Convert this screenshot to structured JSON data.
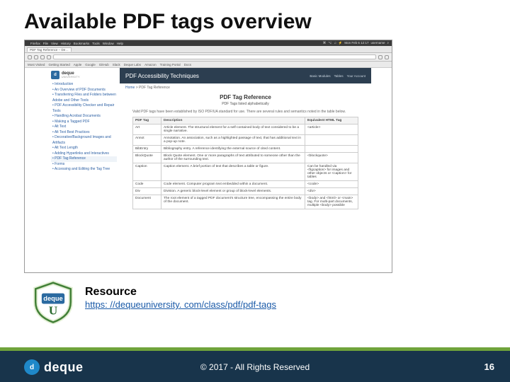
{
  "slide": {
    "title": "Available PDF tags overview",
    "resource_label": "Resource",
    "resource_url": "https: //dequeuniversity. com/class/pdf/pdf-tags",
    "copyright": "© 2017 - All Rights Reserved",
    "page_number": "16",
    "footer_brand": "deque",
    "footer_brand_mark": "d"
  },
  "screenshot": {
    "mac_menu": [
      "Firefox",
      "File",
      "View",
      "History",
      "Bookmarks",
      "Tools",
      "Window",
      "Help"
    ],
    "mac_right": [
      "⌘",
      "⌥",
      "♫",
      "⚡",
      "Mon Feb 6 12:17",
      "username",
      "⌕"
    ],
    "tab_label": "PDF Tag Reference – De…",
    "bookmarks": [
      "Most Visited",
      "Getting Started",
      "Apple",
      "Google",
      "GitHub",
      "Slack",
      "Deque Labs",
      "Amazon",
      "Training Portal",
      "Docs"
    ],
    "brand": "deque",
    "brand_sub": "UNIVERSITY",
    "header_title": "PDF Accessibility Techniques",
    "header_right": [
      "Basic Modules",
      "Tables",
      "Your Account"
    ],
    "breadcrumb_parent": "Home",
    "breadcrumb_sep": " > ",
    "breadcrumb_current": "PDF Tag Reference",
    "page_title": "PDF Tag Reference",
    "page_sub": "PDF Tags listed alphabetically",
    "intro": "Valid PDF tags have been established by ISO PDF/UA standard for use. There are several rules and semantics noted in the table below.",
    "sidebar_items": [
      "Introduction",
      "An Overview of PDF Documents",
      "Transferring Files and Folders between Adobe and Other Tools",
      "PDF Accessibility Checker and Repair Tools",
      "Handling Acrobat Documents",
      "Making a Tagged PDF",
      "Alt Text",
      "Alt Text Best Practices",
      "Decorative/Background Images and Artifacts",
      "Alt Text Length",
      "Adding Hyperlinks and Interactives",
      "PDF Tag Reference",
      "Forms",
      "Accessing and Editing the Tag Tree"
    ],
    "sidebar_selected_index": 11,
    "table": {
      "headers": [
        "PDF Tag",
        "Description",
        "Equivalent HTML Tag"
      ],
      "rows": [
        [
          "Art",
          "Article element. The structural element for a self-contained body of text considered to be a single narrative.",
          "<article>"
        ],
        [
          "Annot",
          "Annotation. An association, such as a highlighted passage of text, that has additional text in a pop-up note.",
          ""
        ],
        [
          "BibEntry",
          "Bibliography entry. A reference identifying the external source of cited content.",
          ""
        ],
        [
          "BlockQuote",
          "Block Quote element. One or more paragraphs of text attributed to someone other than the author of the surrounding text.",
          "<blockquote>"
        ],
        [
          "Caption",
          "Caption element. A brief portion of text that describes a table or figure.",
          "Can be handled via <figcaption> for images and other objects or <caption> for tables"
        ],
        [
          "Code",
          "Code element. Computer program text embedded within a document.",
          "<code>"
        ],
        [
          "Div",
          "Division. A generic block-level element or group of block-level elements.",
          "<div>"
        ],
        [
          "Document",
          "The root element of a tagged PDF document's structure tree, encompassing the entire body of the document.",
          "<body> and <html> or <main> tag. For multi-part documents, multiple <body> possible"
        ]
      ]
    }
  }
}
